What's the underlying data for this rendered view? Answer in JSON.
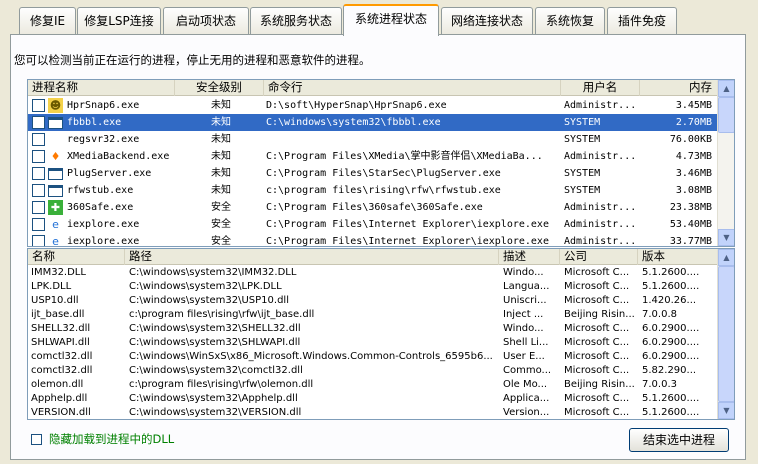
{
  "tabs": [
    {
      "label": "修复IE",
      "active": false
    },
    {
      "label": "修复LSP连接",
      "active": false
    },
    {
      "label": "启动项状态",
      "active": false
    },
    {
      "label": "系统服务状态",
      "active": false
    },
    {
      "label": "系统进程状态",
      "active": true
    },
    {
      "label": "网络连接状态",
      "active": false
    },
    {
      "label": "系统恢复",
      "active": false
    },
    {
      "label": "插件免疫",
      "active": false
    }
  ],
  "intro": "您可以检测当前正在运行的进程，停止无用的进程和恶意软件的进程。",
  "process_table": {
    "columns": [
      "进程名称",
      "安全级别",
      "命令行",
      "用户名",
      "内存"
    ],
    "rows": [
      {
        "name": "HprSnap6.exe",
        "level": "未知",
        "cmd": "D:\\soft\\HyperSnap\\HprSnap6.exe",
        "user": "Administr...",
        "mem": "3.45MB",
        "icon": "hypersnap-icon",
        "selected": false
      },
      {
        "name": "fbbbl.exe",
        "level": "未知",
        "cmd": "C:\\windows\\system32\\fbbbl.exe",
        "user": "SYSTEM",
        "mem": "2.70MB",
        "icon": "window-icon",
        "selected": true
      },
      {
        "name": "regsvr32.exe",
        "level": "未知",
        "cmd": "",
        "user": "SYSTEM",
        "mem": "76.00KB",
        "icon": "",
        "selected": false
      },
      {
        "name": "XMediaBackend.exe",
        "level": "未知",
        "cmd": "C:\\Program Files\\XMedia\\掌中影音伴侣\\XMediaBa...",
        "user": "Administr...",
        "mem": "4.73MB",
        "icon": "flame-icon",
        "selected": false
      },
      {
        "name": "PlugServer.exe",
        "level": "未知",
        "cmd": "C:\\Program Files\\StarSec\\PlugServer.exe",
        "user": "SYSTEM",
        "mem": "3.46MB",
        "icon": "window-icon",
        "selected": false
      },
      {
        "name": "rfwstub.exe",
        "level": "未知",
        "cmd": "c:\\program files\\rising\\rfw\\rfwstub.exe",
        "user": "SYSTEM",
        "mem": "3.08MB",
        "icon": "window-icon",
        "selected": false
      },
      {
        "name": "360Safe.exe",
        "level": "安全",
        "cmd": "C:\\Program Files\\360safe\\360Safe.exe",
        "user": "Administr...",
        "mem": "23.38MB",
        "icon": "shield-icon",
        "selected": false
      },
      {
        "name": "iexplore.exe",
        "level": "安全",
        "cmd": "C:\\Program Files\\Internet Explorer\\iexplore.exe",
        "user": "Administr...",
        "mem": "53.40MB",
        "icon": "ie-icon",
        "selected": false
      },
      {
        "name": "iexplore.exe",
        "level": "安全",
        "cmd": "C:\\Program Files\\Internet Explorer\\iexplore.exe",
        "user": "Administr...",
        "mem": "33.77MB",
        "icon": "ie-icon",
        "selected": false
      }
    ]
  },
  "module_table": {
    "columns": [
      "名称",
      "路径",
      "描述",
      "公司",
      "版本"
    ],
    "rows": [
      {
        "name": "IMM32.DLL",
        "path": "C:\\windows\\system32\\IMM32.DLL",
        "desc": "Windo...",
        "company": "Microsoft C...",
        "version": "5.1.2600...."
      },
      {
        "name": "LPK.DLL",
        "path": "C:\\windows\\system32\\LPK.DLL",
        "desc": "Langua...",
        "company": "Microsoft C...",
        "version": "5.1.2600...."
      },
      {
        "name": "USP10.dll",
        "path": "C:\\windows\\system32\\USP10.dll",
        "desc": "Uniscri...",
        "company": "Microsoft C...",
        "version": "1.420.26..."
      },
      {
        "name": "ijt_base.dll",
        "path": "c:\\program files\\rising\\rfw\\ijt_base.dll",
        "desc": "Inject ...",
        "company": "Beijing Risin...",
        "version": "7.0.0.8"
      },
      {
        "name": "SHELL32.dll",
        "path": "C:\\windows\\system32\\SHELL32.dll",
        "desc": "Windo...",
        "company": "Microsoft C...",
        "version": "6.0.2900...."
      },
      {
        "name": "SHLWAPI.dll",
        "path": "C:\\windows\\system32\\SHLWAPI.dll",
        "desc": "Shell Li...",
        "company": "Microsoft C...",
        "version": "6.0.2900...."
      },
      {
        "name": "comctl32.dll",
        "path": "C:\\windows\\WinSxS\\x86_Microsoft.Windows.Common-Controls_6595b6...",
        "desc": "User E...",
        "company": "Microsoft C...",
        "version": "6.0.2900...."
      },
      {
        "name": "comctl32.dll",
        "path": "C:\\windows\\system32\\comctl32.dll",
        "desc": "Commo...",
        "company": "Microsoft C...",
        "version": "5.82.290..."
      },
      {
        "name": "olemon.dll",
        "path": "c:\\program files\\rising\\rfw\\olemon.dll",
        "desc": "Ole Mo...",
        "company": "Beijing Risin...",
        "version": "7.0.0.3"
      },
      {
        "name": "Apphelp.dll",
        "path": "C:\\windows\\system32\\Apphelp.dll",
        "desc": "Applica...",
        "company": "Microsoft C...",
        "version": "5.1.2600...."
      },
      {
        "name": "VERSION.dll",
        "path": "C:\\windows\\system32\\VERSION.dll",
        "desc": "Version...",
        "company": "Microsoft C...",
        "version": "5.1.2600...."
      }
    ]
  },
  "hide_loaded_dll_label": "隐藏加载到进程中的DLL",
  "end_process_button": "结束选中进程"
}
